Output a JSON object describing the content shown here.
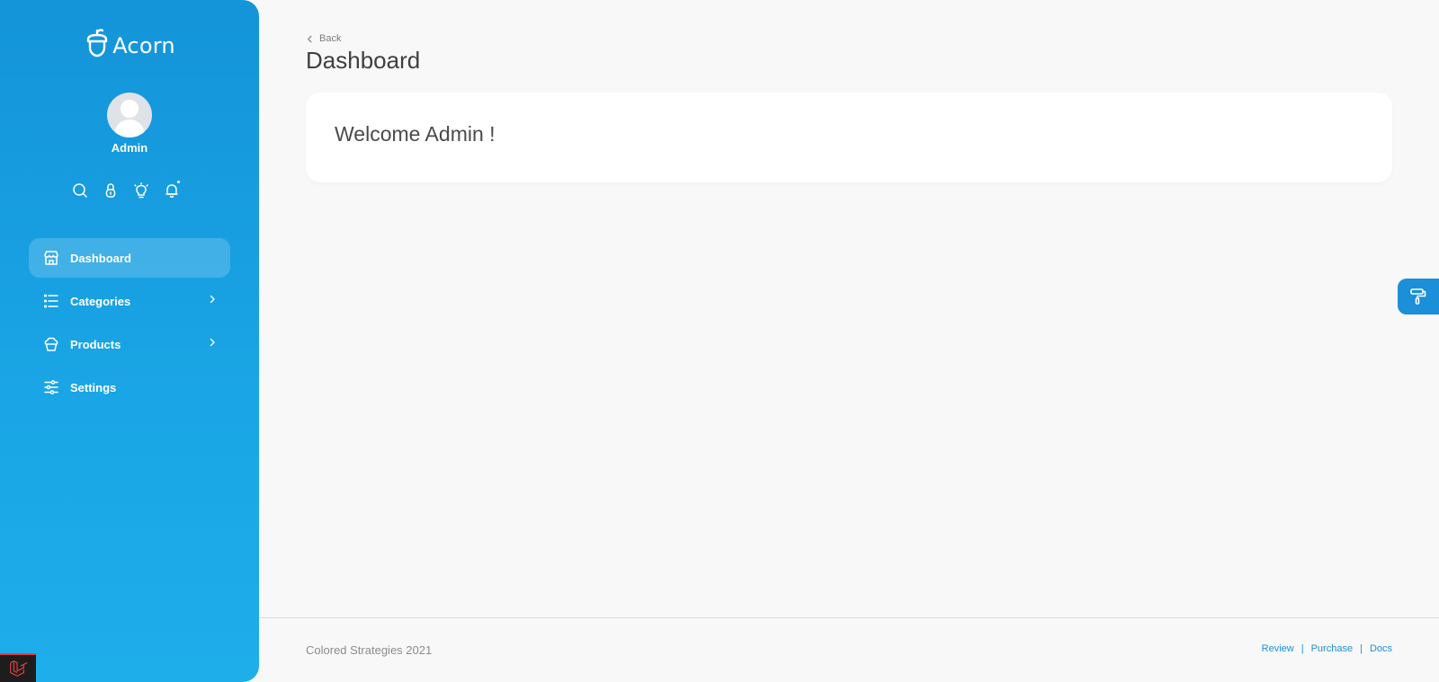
{
  "brand": {
    "name": "Acorn"
  },
  "user": {
    "name": "Admin"
  },
  "sidebar": {
    "top_icons": [
      "search-icon",
      "lock-icon",
      "lightbulb-icon",
      "bell-icon"
    ],
    "items": [
      {
        "label": "Dashboard",
        "icon": "shop-icon",
        "active": true,
        "has_children": false
      },
      {
        "label": "Categories",
        "icon": "list-icon",
        "active": false,
        "has_children": true
      },
      {
        "label": "Products",
        "icon": "cupcake-icon",
        "active": false,
        "has_children": true
      },
      {
        "label": "Settings",
        "icon": "sliders-icon",
        "active": false,
        "has_children": false
      }
    ]
  },
  "header": {
    "back_label": "Back",
    "title": "Dashboard"
  },
  "welcome": {
    "text": "Welcome Admin !"
  },
  "footer": {
    "copyright": "Colored Strategies 2021",
    "links": [
      "Review",
      "Purchase",
      "Docs"
    ],
    "separator": "|"
  },
  "colors": {
    "sidebar_top": "#1494d9",
    "sidebar_bottom": "#1eaeea",
    "accent": "#1c8fd6",
    "page_bg": "#f8f8f8"
  }
}
